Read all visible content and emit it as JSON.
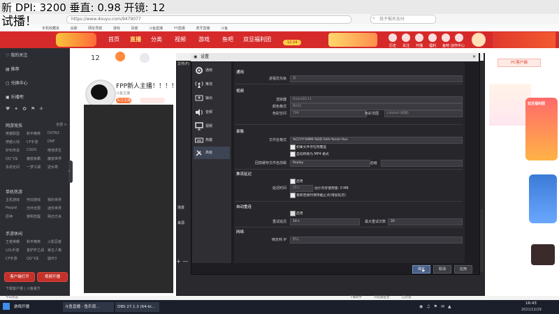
{
  "hud": {
    "line1": "新 DPI: 3200 垂直: 0.98 开镜: 12",
    "line2": "试播！"
  },
  "browser": {
    "url": "https://www.douyu.com/9479077",
    "search_placeholder": "孩子报名加分",
    "bookmarks": [
      "手机收藏夹",
      "谷歌",
      "网址导航",
      "游戏",
      "百度",
      "斗鱼直播",
      "YY直播",
      "虎牙直播",
      "斗鱼"
    ]
  },
  "header": {
    "nav": [
      "首页",
      "直播",
      "分类",
      "视频",
      "游戏",
      "鱼吧",
      "双旦福利团"
    ],
    "badge": "12-24",
    "icons": [
      "历史",
      "关注",
      "开播",
      "福利",
      "鱼吧",
      "创作中心"
    ]
  },
  "sidebar": {
    "items": [
      "我的关注",
      "推荐",
      "兑换中心",
      "乐播吧"
    ],
    "section1": "网游竞技",
    "section1_more": "全部 >",
    "games1": [
      "英雄联盟",
      "和平精英",
      "DOTA2",
      "穿越火线",
      "CF手游",
      "DNF",
      "炉石传说",
      "CSGO",
      "绝地求生",
      "QQ飞车",
      "魔兽争霸",
      "魔兽世界",
      "永劫无间",
      "一梦江湖",
      "逆水寒"
    ],
    "section2": "单机热游",
    "games2": [
      "主机游戏",
      "怀旧游戏",
      "我的世界",
      "Paypal",
      "光环无限",
      "迷你世界",
      "原神",
      "黎明觉醒",
      "明日方舟"
    ],
    "section3": "手游休闲",
    "games3": [
      "王者荣耀",
      "和平精英",
      "火影忍者",
      "LOL手游",
      "金铲铲之战",
      "第五人格",
      "CF手游",
      "QQ飞车",
      "崩坏3"
    ],
    "btn_left": "客户端打开",
    "btn_right": "视频开播",
    "footer": "下载客户端 | 斗鱼官方"
  },
  "stream": {
    "title": "FPP新人主播！！！！！",
    "anchor": "斗鱼主播",
    "tag": "12",
    "tag_label": "关注主播",
    "counts": [
      "12",
      "0"
    ]
  },
  "obs_main": {
    "title": "OBS 27.1.3 (64-bit)",
    "file_menu": "文件(F)",
    "sources_label": "来源",
    "scenes_label": "场景"
  },
  "obs_settings": {
    "title": "设置",
    "categories": [
      {
        "label": "通用",
        "icon": "gear-icon"
      },
      {
        "label": "推流",
        "icon": "broadcast-icon"
      },
      {
        "label": "输出",
        "icon": "output-icon"
      },
      {
        "label": "音频",
        "icon": "speaker-icon"
      },
      {
        "label": "视频",
        "icon": "monitor-icon"
      },
      {
        "label": "热键",
        "icon": "keyboard-icon"
      },
      {
        "label": "高级",
        "icon": "tools-icon"
      }
    ],
    "general_header": "通用",
    "process_priority_label": "进程优先级",
    "process_priority": "高",
    "video_header": "视频",
    "renderer_label": "渲染器",
    "renderer": "Direct3D 11",
    "color_format_label": "颜色格式",
    "color_format": "NV12",
    "color_space_label": "色彩空间",
    "color_space": "709",
    "color_range_label": "色彩范围",
    "color_range": "Limited (局限)",
    "record_header": "录像",
    "filename_label": "文件名格式",
    "filename": "%CCYY-%MM-%DD %hh-%mm-%ss",
    "overwrite_label": "如果文件存在则覆盖",
    "autoremux_label": "自动转换为 MP4 格式",
    "replay_filename_label": "回放缓存文件名前缀",
    "replay_prefix": "Replay",
    "suffix_label": "后缀",
    "stream_delay_header": "推流延迟",
    "enable_label": "启用",
    "delay_label": "延迟时间",
    "delay_value": "20 s",
    "delay_hint": "估计内存使用量: 0 MB",
    "preserve_label": "重新连接时保持截止点(增加延迟)",
    "reconnect_header": "自动重连",
    "enable2_label": "启用",
    "retry_delay_label": "重试延迟",
    "retry_delay": "10 s",
    "max_retries_label": "最大重试次数",
    "max_retries": "20",
    "network_header": "网络",
    "bind_ip_label": "绑定到 IP",
    "bind_ip": "默认",
    "buttons": [
      "确定",
      "取消",
      "应用"
    ]
  },
  "right": {
    "pc_label": "PC客户端",
    "banner": "双旦福利团"
  },
  "statusbar": {
    "left": "今日优选",
    "items": [
      "下载助手",
      "浏览器医生",
      "已过滤"
    ]
  },
  "taskbar": {
    "items": [
      "游戏开播",
      "斗鱼直播 - 鱼乐观...",
      "OBS 27.1.3 (64-bi..."
    ],
    "time": "16:43",
    "date": "2021/12/29"
  },
  "colors": {
    "brand": "#d62a2a",
    "sidebar": "#2c2d33",
    "obs_bg": "#1e1e22",
    "accent": "#4a5f88"
  }
}
